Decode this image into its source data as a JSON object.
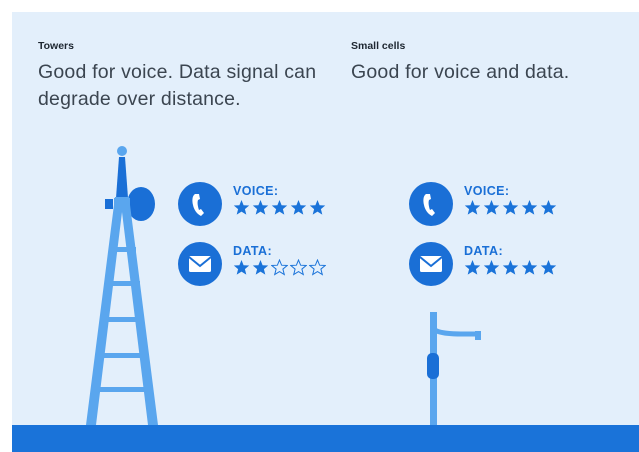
{
  "towers": {
    "heading": "Towers",
    "description": "Good for voice. Data signal can degrade over distance.",
    "voice": {
      "label": "VOICE:",
      "rating": 5,
      "max": 5
    },
    "data": {
      "label": "DATA:",
      "rating": 2,
      "max": 5
    }
  },
  "small_cells": {
    "heading": "Small cells",
    "description": "Good for voice and data.",
    "voice": {
      "label": "VOICE:",
      "rating": 5,
      "max": 5
    },
    "data": {
      "label": "DATA:",
      "rating": 5,
      "max": 5
    }
  },
  "icons": {
    "voice": "phone-icon",
    "data": "envelope-icon",
    "tower": "cell-tower-icon",
    "small_cell": "streetlight-small-cell-icon"
  },
  "colors": {
    "background": "#e3effb",
    "accent": "#1a73d9",
    "illustration": "#5aa6ee",
    "text": "#3b4550"
  }
}
